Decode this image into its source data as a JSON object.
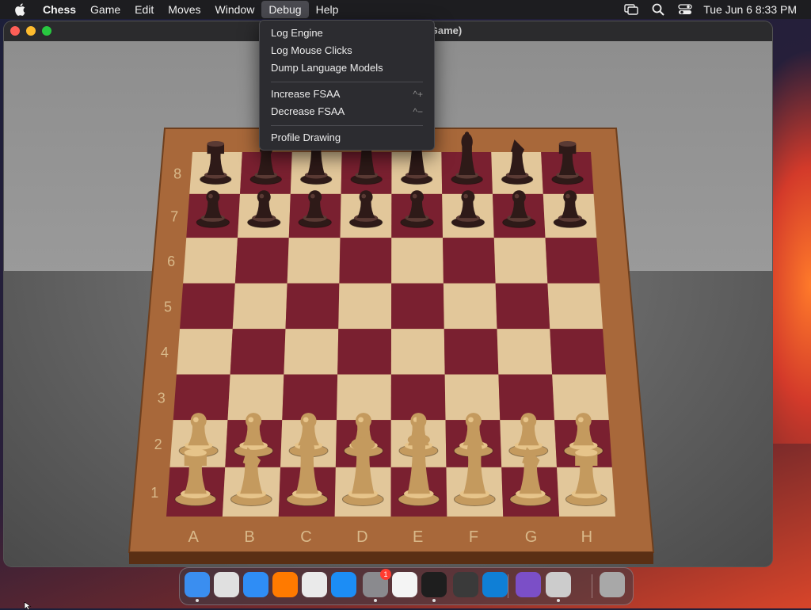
{
  "menubar": {
    "app_name": "Chess",
    "items": [
      "Game",
      "Edit",
      "Moves",
      "Window",
      "Debug",
      "Help"
    ],
    "active_item": "Debug",
    "clock": "Tue Jun 6  8:33 PM"
  },
  "window": {
    "title": "Game)"
  },
  "debug_menu": {
    "items": [
      {
        "label": "Log Engine",
        "shortcut": ""
      },
      {
        "label": "Log Mouse Clicks",
        "shortcut": ""
      },
      {
        "label": "Dump Language Models",
        "shortcut": ""
      },
      {
        "label": "Increase FSAA",
        "shortcut": "^+"
      },
      {
        "label": "Decrease FSAA",
        "shortcut": "^−"
      },
      {
        "label": "Profile Drawing",
        "shortcut": ""
      }
    ]
  },
  "board": {
    "files": [
      "A",
      "B",
      "C",
      "D",
      "E",
      "F",
      "G",
      "H"
    ],
    "ranks": [
      "8",
      "7",
      "6",
      "5",
      "4",
      "3",
      "2",
      "1"
    ],
    "light_square_color": "#e2c79a",
    "dark_square_color": "#7a2030",
    "frame_color": "#a8683a",
    "pieces": {
      "black_back": [
        "rook",
        "knight",
        "bishop",
        "queen",
        "king",
        "bishop",
        "knight",
        "rook"
      ],
      "white_back": [
        "rook",
        "knight",
        "bishop",
        "queen",
        "king",
        "bishop",
        "knight",
        "rook"
      ],
      "black_pawns": 8,
      "white_pawns": 8
    },
    "black_piece_color": "#2e1a18",
    "white_piece_color": "#c49a5e"
  },
  "dock": {
    "apps": [
      {
        "name": "finder-icon",
        "color": "#3a8ef0",
        "running": true
      },
      {
        "name": "launchpad-icon",
        "color": "#e0e0e0",
        "running": false
      },
      {
        "name": "safari-icon",
        "color": "#2f8df5",
        "running": false
      },
      {
        "name": "firefox-icon",
        "color": "#ff7a00",
        "running": false
      },
      {
        "name": "chrome-icon",
        "color": "#eaeaea",
        "running": false
      },
      {
        "name": "app-store-icon",
        "color": "#1c8df5",
        "running": false
      },
      {
        "name": "system-settings-icon",
        "color": "#8a8a8e",
        "running": true,
        "badge": "1"
      },
      {
        "name": "textedit-icon",
        "color": "#f4f4f4",
        "running": false
      },
      {
        "name": "terminal-icon",
        "color": "#1e1e1e",
        "running": true
      },
      {
        "name": "instruments-icon",
        "color": "#3a3a3a",
        "running": false
      },
      {
        "name": "vscode-icon",
        "color": "#0f7fd6",
        "running": false
      },
      {
        "name": "visual-studio-icon",
        "color": "#7b4fc7",
        "running": false
      },
      {
        "name": "chess-icon",
        "color": "#cccccc",
        "running": true
      },
      {
        "name": "trash-icon",
        "color": "#a8a8a8",
        "running": false
      }
    ]
  }
}
